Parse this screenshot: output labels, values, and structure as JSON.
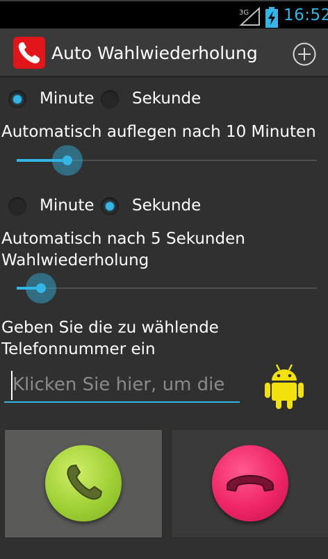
{
  "status_bar": {
    "network": "3G",
    "time": "16:52"
  },
  "action_bar": {
    "title": "Auto Wahlwiederholung",
    "app_icon": "phone-icon",
    "add_icon": "add-circle-icon"
  },
  "hangup_group": {
    "option_minute": "Minute",
    "option_second": "Sekunde",
    "selected": "Minute",
    "label": "Automatisch auflegen nach 10 Minuten",
    "slider_fraction": 0.17
  },
  "redial_group": {
    "option_minute": "Minute",
    "option_second": "Sekunde",
    "selected": "Sekunde",
    "label_line1": "Automatisch nach 5 Sekunden",
    "label_line2": "Wahlwiederholung",
    "slider_fraction": 0.08
  },
  "phone_number": {
    "prompt_line1": "Geben Sie die zu wählende",
    "prompt_line2": "Telefonnummer ein",
    "placeholder": "Klicken Sie hier, um die",
    "value": "",
    "contact_icon": "android-icon"
  },
  "buttons": {
    "dial_icon": "phone-call-icon",
    "hangup_icon": "phone-hangup-icon"
  },
  "colors": {
    "accent": "#33b5e5",
    "dial_green": "#9fd035",
    "hangup_pink": "#ef2566",
    "app_icon_red": "#e2151b"
  }
}
